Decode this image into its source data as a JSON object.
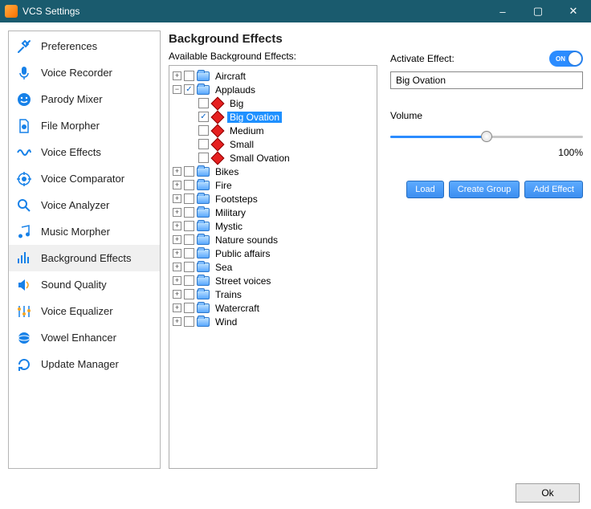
{
  "window": {
    "title": "VCS Settings"
  },
  "sidebar": {
    "items": [
      {
        "label": "Preferences"
      },
      {
        "label": "Voice Recorder"
      },
      {
        "label": "Parody Mixer"
      },
      {
        "label": "File Morpher"
      },
      {
        "label": "Voice Effects"
      },
      {
        "label": "Voice Comparator"
      },
      {
        "label": "Voice Analyzer"
      },
      {
        "label": "Music Morpher"
      },
      {
        "label": "Background Effects"
      },
      {
        "label": "Sound Quality"
      },
      {
        "label": "Voice Equalizer"
      },
      {
        "label": "Vowel Enhancer"
      },
      {
        "label": "Update Manager"
      }
    ]
  },
  "main": {
    "heading": "Background Effects",
    "available_label": "Available Background Effects:",
    "tree": {
      "folders": [
        {
          "label": "Aircraft"
        },
        {
          "label": "Applauds"
        },
        {
          "label": "Bikes"
        },
        {
          "label": "Fire"
        },
        {
          "label": "Footsteps"
        },
        {
          "label": "Military"
        },
        {
          "label": "Mystic"
        },
        {
          "label": "Nature sounds"
        },
        {
          "label": "Public affairs"
        },
        {
          "label": "Sea"
        },
        {
          "label": "Street voices"
        },
        {
          "label": "Trains"
        },
        {
          "label": "Watercraft"
        },
        {
          "label": "Wind"
        }
      ],
      "applauds_children": [
        {
          "label": "Big"
        },
        {
          "label": "Big Ovation"
        },
        {
          "label": "Medium"
        },
        {
          "label": "Small"
        },
        {
          "label": "Small Ovation"
        }
      ]
    }
  },
  "controls": {
    "activate_label": "Activate Effect:",
    "toggle_text": "ON",
    "effect_name": "Big Ovation",
    "volume_label": "Volume",
    "volume_value": "100%",
    "buttons": {
      "load": "Load",
      "create_group": "Create Group",
      "add_effect": "Add Effect"
    }
  },
  "footer": {
    "ok": "Ok"
  }
}
